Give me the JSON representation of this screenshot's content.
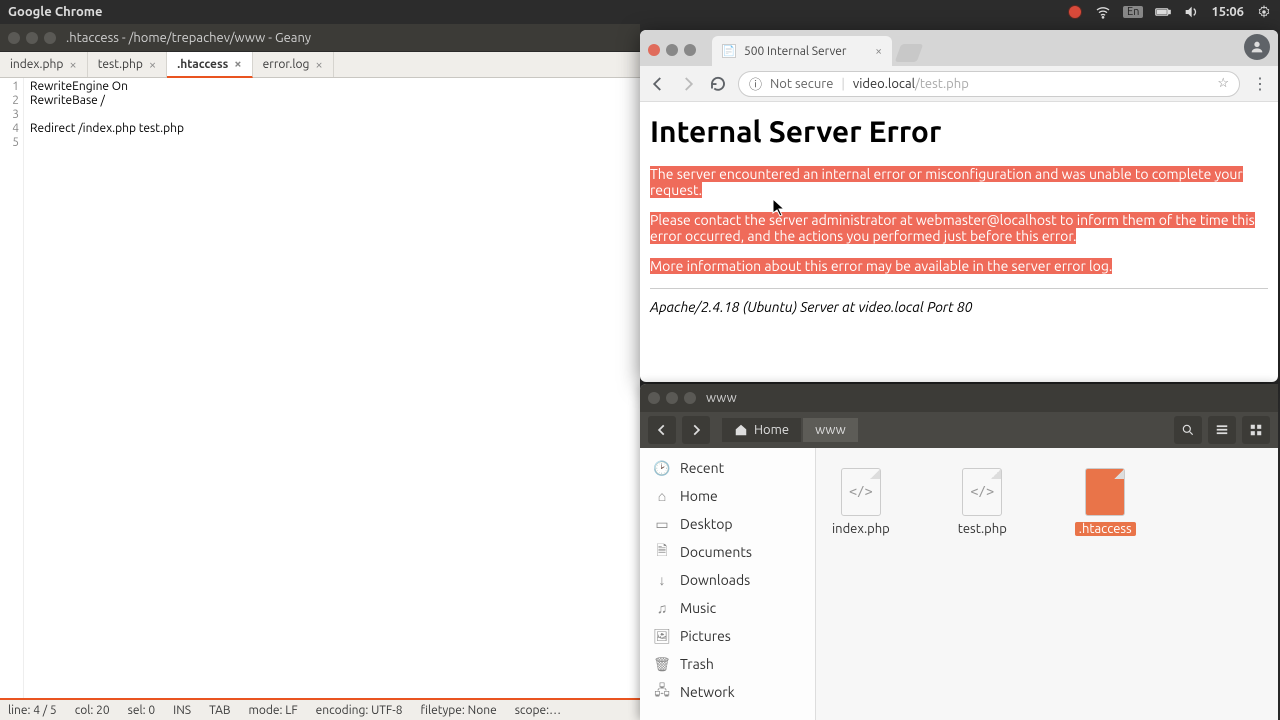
{
  "topbar": {
    "title": "Google Chrome",
    "lang": "En",
    "time": "15:06"
  },
  "geany": {
    "title": ".htaccess - /home/trepachev/www - Geany",
    "tabs": [
      {
        "label": "index.php"
      },
      {
        "label": "test.php"
      },
      {
        "label": ".htaccess"
      },
      {
        "label": "error.log"
      }
    ],
    "lines": [
      "1",
      "2",
      "3",
      "4",
      "5"
    ],
    "code": "RewriteEngine On\nRewriteBase /\n\nRedirect /index.php test.php\n",
    "status": {
      "line": "line: 4 / 5",
      "col": "col: 20",
      "sel": "sel: 0",
      "ins": "INS",
      "tab": "TAB",
      "mode": "mode: LF",
      "encoding": "encoding: UTF-8",
      "filetype": "filetype: None",
      "scope": "scope:…"
    }
  },
  "chrome": {
    "tab_title": "500 Internal Server",
    "not_secure": "Not secure",
    "url_host": "video.local",
    "url_path": "/test.php",
    "page": {
      "h1": "Internal Server Error",
      "p1": "The server encountered an internal error or misconfiguration and was unable to complete your request.",
      "p2": "Please contact the server administrator at webmaster@localhost to inform them of the time this error occurred, and the actions you performed just before this error.",
      "p3": "More information about this error may be available in the server error log.",
      "footer": "Apache/2.4.18 (Ubuntu) Server at video.local Port 80"
    }
  },
  "files": {
    "title": "www",
    "path": {
      "home": "Home",
      "current": "www"
    },
    "sidebar": [
      "Recent",
      "Home",
      "Desktop",
      "Documents",
      "Downloads",
      "Music",
      "Pictures",
      "Trash",
      "Network"
    ],
    "items": [
      {
        "name": "index.php"
      },
      {
        "name": "test.php"
      },
      {
        "name": ".htaccess"
      }
    ]
  }
}
